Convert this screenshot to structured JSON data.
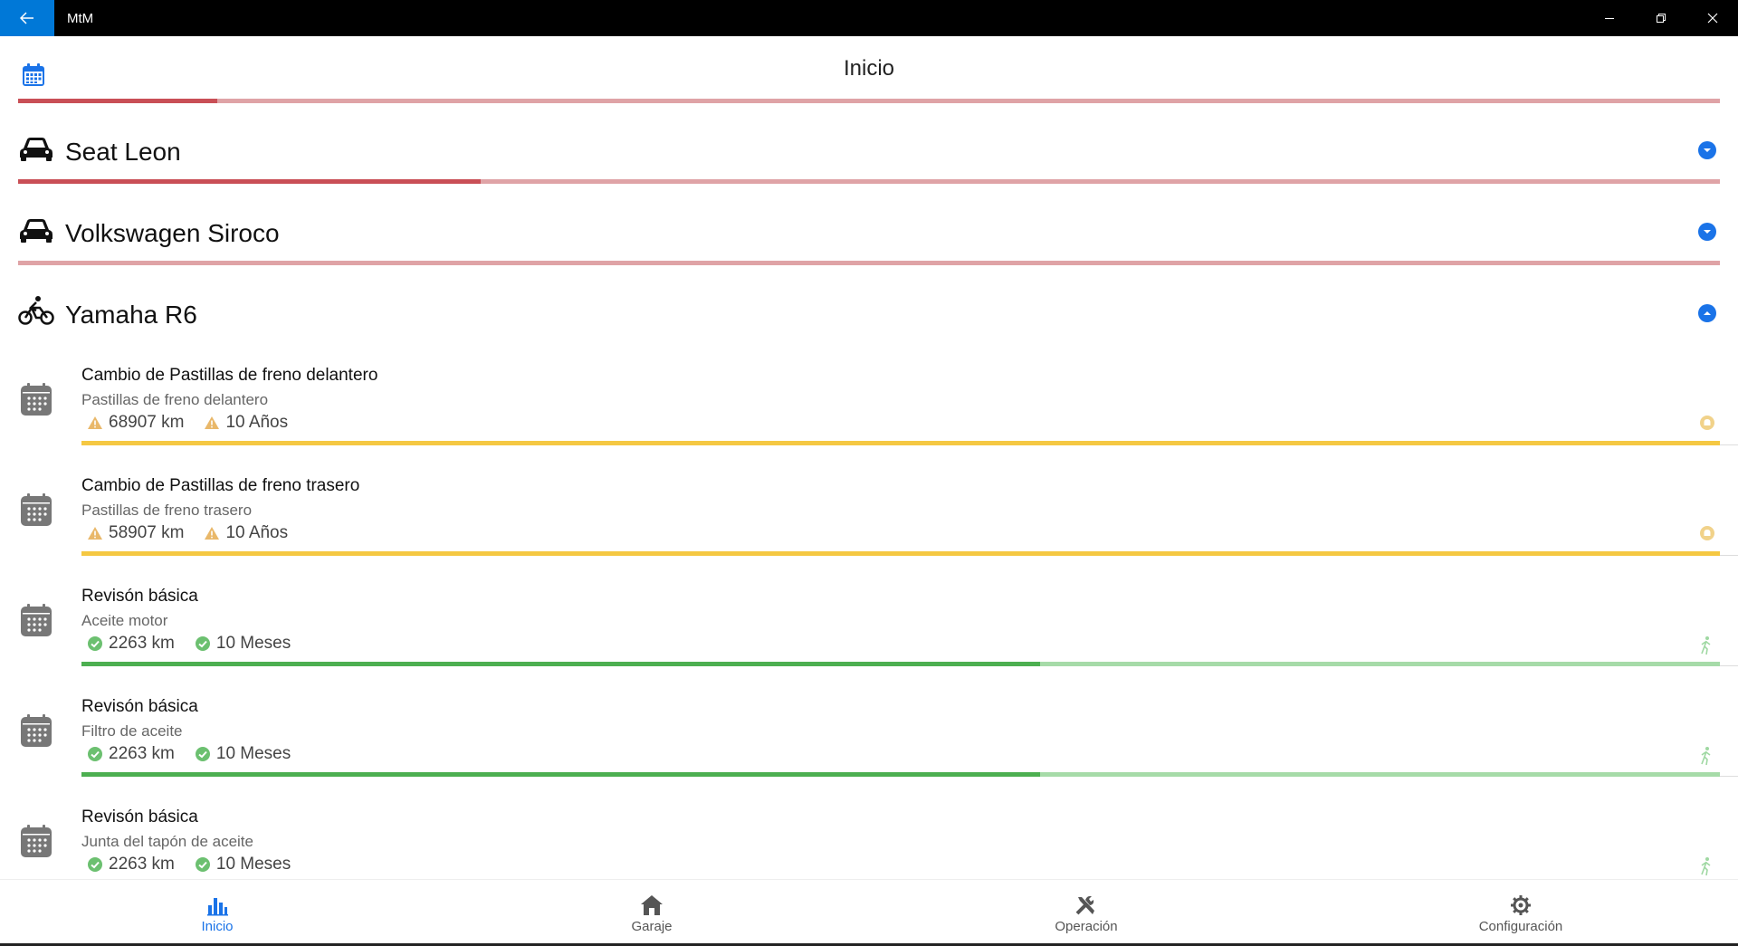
{
  "window": {
    "title": "MtM"
  },
  "header": {
    "title": "Inicio",
    "progress": 0.117
  },
  "vehicles": [
    {
      "name": "Seat Leon",
      "icon": "car-icon",
      "expanded": false,
      "progress": 0.272
    },
    {
      "name": "Volkswagen Siroco",
      "icon": "car-icon",
      "expanded": false,
      "progress": 0.0
    },
    {
      "name": "Yamaha R6",
      "icon": "motorcycle-icon",
      "expanded": true
    }
  ],
  "tasks": [
    {
      "title": "Cambio de Pastillas de freno delantero",
      "part": "Pastillas de freno delantero",
      "km": "68907 km",
      "time": "10 Años",
      "status": "warning",
      "progress": 1.0,
      "bar_color": "#f5c842",
      "bar_track": "#f5c842"
    },
    {
      "title": "Cambio de Pastillas de freno trasero",
      "part": "Pastillas de freno trasero",
      "km": "58907 km",
      "time": "10 Años",
      "status": "warning",
      "progress": 1.0,
      "bar_color": "#f5c842",
      "bar_track": "#f5c842"
    },
    {
      "title": "Revisón básica",
      "part": "Aceite motor",
      "km": "2263 km",
      "time": "10 Meses",
      "status": "ok",
      "progress": 0.585,
      "bar_color": "#4caf50",
      "bar_track": "#a6dba8"
    },
    {
      "title": "Revisón básica",
      "part": "Filtro de aceite",
      "km": "2263 km",
      "time": "10 Meses",
      "status": "ok",
      "progress": 0.585,
      "bar_color": "#4caf50",
      "bar_track": "#a6dba8"
    },
    {
      "title": "Revisón básica",
      "part": "Junta del tapón de aceite",
      "km": "2263 km",
      "time": "10 Meses",
      "status": "ok",
      "progress": 0.585,
      "bar_color": "#4caf50",
      "bar_track": "#a6dba8"
    }
  ],
  "nav": {
    "items": [
      {
        "label": "Inicio",
        "icon": "chart-icon",
        "active": true
      },
      {
        "label": "Garaje",
        "icon": "home-icon",
        "active": false
      },
      {
        "label": "Operación",
        "icon": "tools-icon",
        "active": false
      },
      {
        "label": "Configuración",
        "icon": "gear-icon",
        "active": false
      }
    ]
  },
  "colors": {
    "accent": "#1a73e8",
    "danger": "#c94f56",
    "warning": "#f5c842",
    "ok": "#4caf50"
  }
}
